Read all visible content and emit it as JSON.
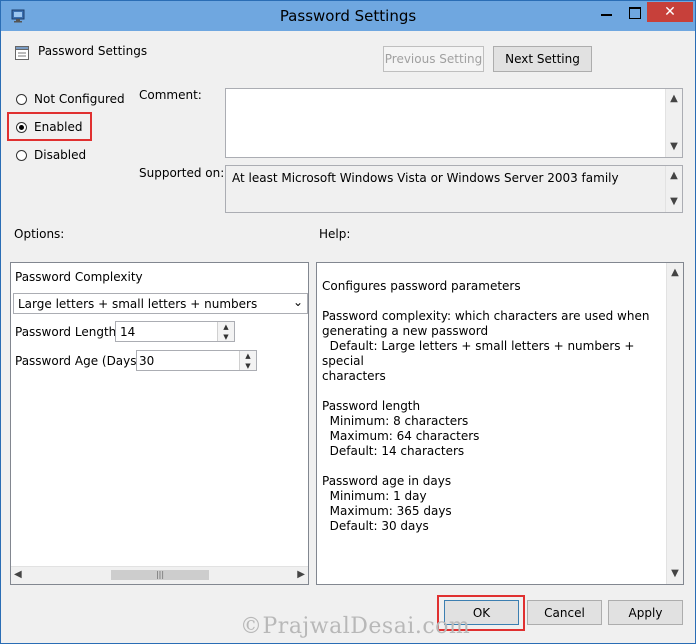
{
  "window": {
    "title": "Password Settings"
  },
  "header": {
    "heading": "Password Settings",
    "previous_label": "Previous Setting",
    "next_label": "Next Setting"
  },
  "state": {
    "options": [
      {
        "label": "Not Configured",
        "checked": false
      },
      {
        "label": "Enabled",
        "checked": true
      },
      {
        "label": "Disabled",
        "checked": false
      }
    ]
  },
  "comment": {
    "label": "Comment:",
    "value": ""
  },
  "supported": {
    "label": "Supported on:",
    "value": "At least Microsoft Windows Vista or Windows Server 2003 family"
  },
  "options_panel": {
    "label": "Options:",
    "complexity_label": "Password Complexity",
    "complexity_value": "Large letters + small letters + numbers",
    "length_label": "Password Length",
    "length_value": "14",
    "age_label": "Password Age (Days)",
    "age_value": "30"
  },
  "help_panel": {
    "label": "Help:",
    "text": "Configures password parameters\n\nPassword complexity: which characters are used when\ngenerating a new password\n  Default: Large letters + small letters + numbers + special\ncharacters\n\nPassword length\n  Minimum: 8 characters\n  Maximum: 64 characters\n  Default: 14 characters\n\nPassword age in days\n  Minimum: 1 day\n  Maximum: 365 days\n  Default: 30 days"
  },
  "footer": {
    "ok_label": "OK",
    "cancel_label": "Cancel",
    "apply_label": "Apply"
  },
  "watermark": {
    "text": "©PrajwalDesai.com"
  },
  "colors": {
    "titlebar": "#6fa7e0",
    "close": "#c7403a",
    "highlight": "#e03030"
  }
}
